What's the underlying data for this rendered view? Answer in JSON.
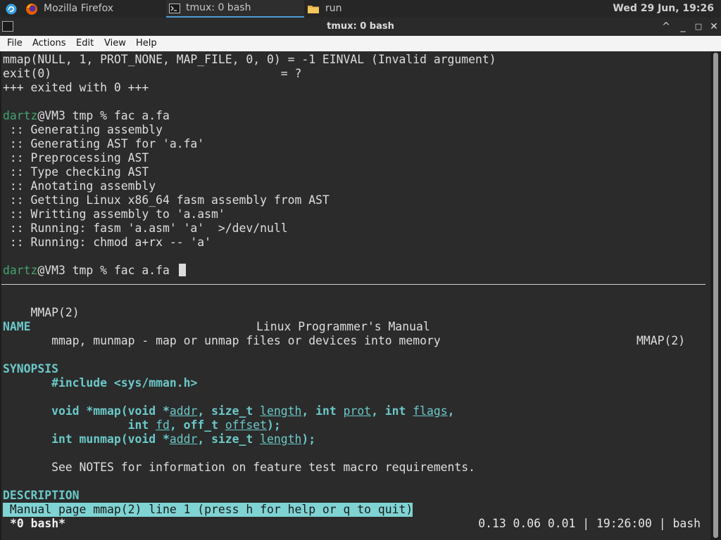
{
  "taskbar": {
    "firefox_label": "Mozilla Firefox",
    "tmux_label": "tmux: 0 bash",
    "run_label": "run",
    "clock": "Wed 29 Jun, 19:26"
  },
  "window": {
    "title": "tmux: 0 bash",
    "buttons": {
      "up": "^",
      "minimize": "_",
      "maximize": "□",
      "close": "✕"
    }
  },
  "menubar": {
    "file": "File",
    "actions": "Actions",
    "edit": "Edit",
    "view": "View",
    "help": "Help"
  },
  "terminal": {
    "top_lines": [
      "mmap(NULL, 1, PROT_NONE, MAP_FILE, 0, 0) = -1 EINVAL (Invalid argument)",
      "exit(0)                                 = ?",
      "+++ exited with 0 +++",
      "",
      "",
      " :: Generating assembly",
      " :: Generating AST for 'a.fa'",
      " :: Preprocessing AST",
      " :: Type checking AST",
      " :: Anotating assembly",
      " :: Getting Linux x86_64 fasm assembly from AST",
      " :: Writting assembly to 'a.asm'",
      " :: Running: fasm 'a.asm' 'a'  >/dev/null",
      " :: Running: chmod a+rx -- 'a'"
    ],
    "prompt_user": "dartz",
    "prompt_rest": "@VM3 tmp % ",
    "command1": "fac a.fa",
    "command2": "fac a.fa "
  },
  "man": {
    "header_left": "MMAP(2)",
    "header_center": "Linux Programmer's Manual",
    "header_right": "MMAP(2)",
    "name_heading": "NAME",
    "name_text": "       mmap, munmap - map or unmap files or devices into memory",
    "synopsis_heading": "SYNOPSIS",
    "include": "#include <sys/mman.h>",
    "notes": "       See NOTES for information on feature test macro requirements.",
    "description_heading": "DESCRIPTION",
    "status_line": " Manual page mmap(2) line 1 (press h for help or q to quit)"
  },
  "tmux": {
    "window": "*0 bash*",
    "right": "0.13 0.06 0.01 | 19:26:00 | bash"
  }
}
